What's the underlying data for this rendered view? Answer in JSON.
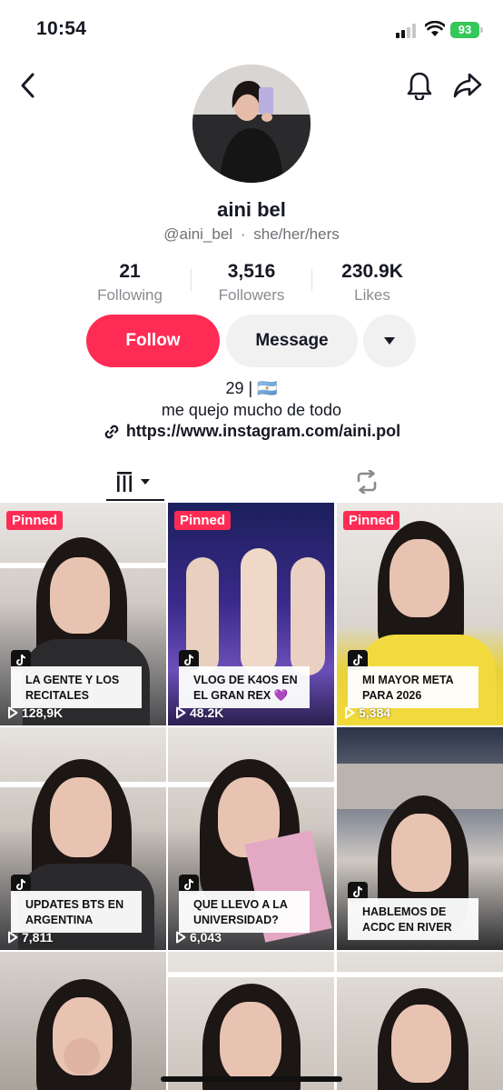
{
  "status_bar": {
    "time": "10:54",
    "battery": "93"
  },
  "profile": {
    "name": "aini bel",
    "handle": "@aini_bel",
    "pronouns": "she/her/hers",
    "separator": "·"
  },
  "stats": [
    {
      "value": "21",
      "label": "Following"
    },
    {
      "value": "3,516",
      "label": "Followers"
    },
    {
      "value": "230.9K",
      "label": "Likes"
    }
  ],
  "actions": {
    "follow": "Follow",
    "message": "Message"
  },
  "bio": {
    "line1": "29 | 🇦🇷",
    "line2": "me quejo mucho de todo",
    "link": "https://www.instagram.com/aini.pol"
  },
  "videos": [
    {
      "pinned": "Pinned",
      "caption": "LA GENTE Y LOS RECITALES",
      "views": "128,9K"
    },
    {
      "pinned": "Pinned",
      "caption": "VLOG DE K4OS EN EL GRAN REX 💜",
      "views": "48.2K"
    },
    {
      "pinned": "Pinned",
      "caption": "MI MAYOR META PARA 2026",
      "views": "5,384"
    },
    {
      "pinned": "",
      "caption": "UPDATES BTS EN ARGENTINA",
      "views": "7,811"
    },
    {
      "pinned": "",
      "caption": "QUE LLEVO A LA UNIVERSIDAD?",
      "views": "6,043"
    },
    {
      "pinned": "",
      "caption": "HABLEMOS DE ACDC EN RIVER",
      "views": ""
    },
    {
      "pinned": "",
      "caption": "",
      "views": ""
    },
    {
      "pinned": "",
      "caption": "",
      "views": ""
    },
    {
      "pinned": "",
      "caption": "",
      "views": ""
    }
  ],
  "colors": {
    "accent": "#fe2c55",
    "text": "#161823",
    "muted": "#8a8b91"
  }
}
